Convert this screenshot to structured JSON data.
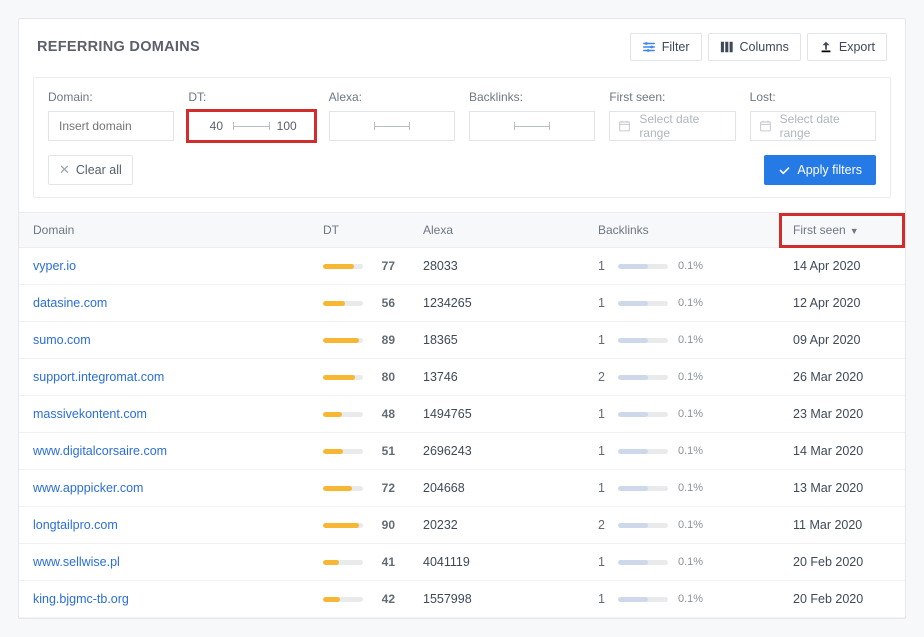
{
  "header": {
    "title": "REFERRING DOMAINS",
    "filter_btn": "Filter",
    "columns_btn": "Columns",
    "export_btn": "Export"
  },
  "filters": {
    "domain": {
      "label": "Domain:",
      "placeholder": "Insert domain"
    },
    "dt": {
      "label": "DT:",
      "min": "40",
      "max": "100"
    },
    "alexa": {
      "label": "Alexa:"
    },
    "backlinks": {
      "label": "Backlinks:"
    },
    "firstseen": {
      "label": "First seen:",
      "placeholder": "Select date range"
    },
    "lost": {
      "label": "Lost:",
      "placeholder": "Select date range"
    },
    "clear_all": "Clear all",
    "apply": "Apply filters"
  },
  "table": {
    "headers": {
      "domain": "Domain",
      "dt": "DT",
      "alexa": "Alexa",
      "backlinks": "Backlinks",
      "firstseen": "First seen"
    },
    "rows": [
      {
        "domain": "vyper.io",
        "dt": 77,
        "alexa": "28033",
        "bl_count": 1,
        "bl_pct": "0.1%",
        "firstseen": "14 Apr 2020"
      },
      {
        "domain": "datasine.com",
        "dt": 56,
        "alexa": "1234265",
        "bl_count": 1,
        "bl_pct": "0.1%",
        "firstseen": "12 Apr 2020"
      },
      {
        "domain": "sumo.com",
        "dt": 89,
        "alexa": "18365",
        "bl_count": 1,
        "bl_pct": "0.1%",
        "firstseen": "09 Apr 2020"
      },
      {
        "domain": "support.integromat.com",
        "dt": 80,
        "alexa": "13746",
        "bl_count": 2,
        "bl_pct": "0.1%",
        "firstseen": "26 Mar 2020"
      },
      {
        "domain": "massivekontent.com",
        "dt": 48,
        "alexa": "1494765",
        "bl_count": 1,
        "bl_pct": "0.1%",
        "firstseen": "23 Mar 2020"
      },
      {
        "domain": "www.digitalcorsaire.com",
        "dt": 51,
        "alexa": "2696243",
        "bl_count": 1,
        "bl_pct": "0.1%",
        "firstseen": "14 Mar 2020"
      },
      {
        "domain": "www.apppicker.com",
        "dt": 72,
        "alexa": "204668",
        "bl_count": 1,
        "bl_pct": "0.1%",
        "firstseen": "13 Mar 2020"
      },
      {
        "domain": "longtailpro.com",
        "dt": 90,
        "alexa": "20232",
        "bl_count": 2,
        "bl_pct": "0.1%",
        "firstseen": "11 Mar 2020"
      },
      {
        "domain": "www.sellwise.pl",
        "dt": 41,
        "alexa": "4041119",
        "bl_count": 1,
        "bl_pct": "0.1%",
        "firstseen": "20 Feb 2020"
      },
      {
        "domain": "king.bjgmc-tb.org",
        "dt": 42,
        "alexa": "1557998",
        "bl_count": 1,
        "bl_pct": "0.1%",
        "firstseen": "20 Feb 2020"
      }
    ]
  }
}
